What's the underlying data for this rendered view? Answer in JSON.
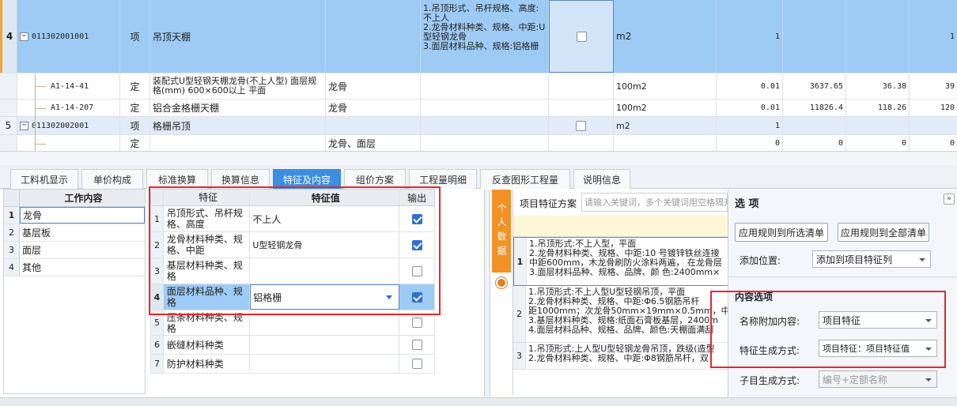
{
  "top_grid": {
    "rows": [
      {
        "idx": "4",
        "code": "011302001001",
        "type": "项",
        "name": "吊顶天棚",
        "material": "",
        "features": "1.吊顶形式、吊杆规格、高度:不上人\n2.龙骨材料种类、规格、中距:U型轻钢龙骨\n3.面层材料品种、规格:铝格栅",
        "unit": "m2",
        "qty": "1",
        "price": "",
        "sum": "",
        "extra": "1"
      },
      {
        "idx": "",
        "code": "A1-14-41",
        "type": "定",
        "name": "装配式U型轻钢天棚龙骨(不上人型) 面层规格(mm) 600×600以上 平面",
        "material": "龙骨",
        "features": "",
        "unit": "100m2",
        "qty": "0.01",
        "price": "3637.65",
        "sum": "36.38",
        "extra": "39"
      },
      {
        "idx": "",
        "code": "A1-14-207",
        "type": "定",
        "name": "铝合金格栅天棚",
        "material": "龙骨",
        "features": "",
        "unit": "100m2",
        "qty": "0.01",
        "price": "11826.4",
        "sum": "118.26",
        "extra": "120"
      },
      {
        "idx": "5",
        "code": "011302002001",
        "type": "项",
        "name": "格栅吊顶",
        "material": "",
        "features": "",
        "unit": "m2",
        "qty": "1",
        "price": "",
        "sum": "",
        "extra": ""
      },
      {
        "idx": "",
        "code": "",
        "type": "定",
        "name": "",
        "material": "龙骨、面层",
        "features": "",
        "unit": "",
        "qty": "0",
        "price": "0",
        "sum": "0",
        "extra": "0"
      }
    ]
  },
  "tabs": [
    "工料机显示",
    "单价构成",
    "标准换算",
    "换算信息",
    "特征及内容",
    "组价方案",
    "工程量明细",
    "反查图形工程量",
    "说明信息"
  ],
  "active_tab": "特征及内容",
  "work_content": {
    "header": "工作内容",
    "items": [
      {
        "idx": "1",
        "text": "龙骨"
      },
      {
        "idx": "2",
        "text": "基层板"
      },
      {
        "idx": "3",
        "text": "面层"
      },
      {
        "idx": "4",
        "text": "其他"
      }
    ]
  },
  "features": {
    "header_name": "特征",
    "header_value": "特征值",
    "header_output": "输出",
    "rows": [
      {
        "idx": "1",
        "name": "吊顶形式、吊杆规格、高度",
        "value": "不上人",
        "output": true
      },
      {
        "idx": "2",
        "name": "龙骨材料种类、规格、中距",
        "value": "U型轻钢龙骨",
        "output": true
      },
      {
        "idx": "3",
        "name": "基层材料种类、规格",
        "value": "",
        "output": false
      },
      {
        "idx": "4",
        "name": "面层材料品种、规格",
        "value": "铝格栅",
        "output": true
      },
      {
        "idx": "5",
        "name": "压条材料种类、规格",
        "value": "",
        "output": false
      },
      {
        "idx": "6",
        "name": "嵌缝材料种类",
        "value": "",
        "output": false
      },
      {
        "idx": "7",
        "name": "防护材料种类",
        "value": "",
        "output": false
      }
    ]
  },
  "personal_data_tab": "个人数据",
  "project_feature": {
    "label": "项目特征方案",
    "search_placeholder": "请输入关键词，多个关键词用空格隔开",
    "rows": [
      {
        "idx": "1",
        "text": "1.吊顶形式:不上人型，平面\n2.龙骨材料种类、规格、中距:10 号镀锌铁丝连接\n中距600mm，木龙骨刷防火涂料两遍， 在龙骨层\n3.面层材料品种、规格、品牌、颜 色:2400mm×"
      },
      {
        "idx": "2",
        "text": "1.吊顶形式:不上人型U型轻钢吊顶，平面\n2.龙骨材料种类、规格、中距:Φ6.5钢筋吊杆\n距1000mm；次龙骨50mm×19mm×0.5mm，中距450\n3.基层材料种类、规格:纸面石膏板基层，2400m\n4.面层材料品种、规格、品牌、颜色:天棚面满刮"
      },
      {
        "idx": "3",
        "text": "1.吊顶形式:上人型U型轻钢龙骨吊顶，跌级(造型\n2.龙骨材料种类、规格、中距:Φ8钢筋吊杆，双"
      }
    ]
  },
  "options": {
    "title": "选 项",
    "btn_selected": "应用规则到所选清单",
    "btn_all": "应用规则到全部清单",
    "add_pos_label": "添加位置:",
    "add_pos_value": "添加到项目特征列",
    "content_options_title": "内容选项",
    "name_append_label": "名称附加内容:",
    "name_append_value": "项目特征",
    "feature_gen_label": "特征生成方式:",
    "feature_gen_value": "项目特征：项目特征值",
    "sub_gen_label": "子目生成方式:",
    "sub_gen_value": "编号+定额名称"
  },
  "colors": {
    "accent": "#3b8ee0",
    "selected_row": "#9ecbf4",
    "highlight_red": "#e8262b",
    "orange_tab": "#f29126"
  }
}
